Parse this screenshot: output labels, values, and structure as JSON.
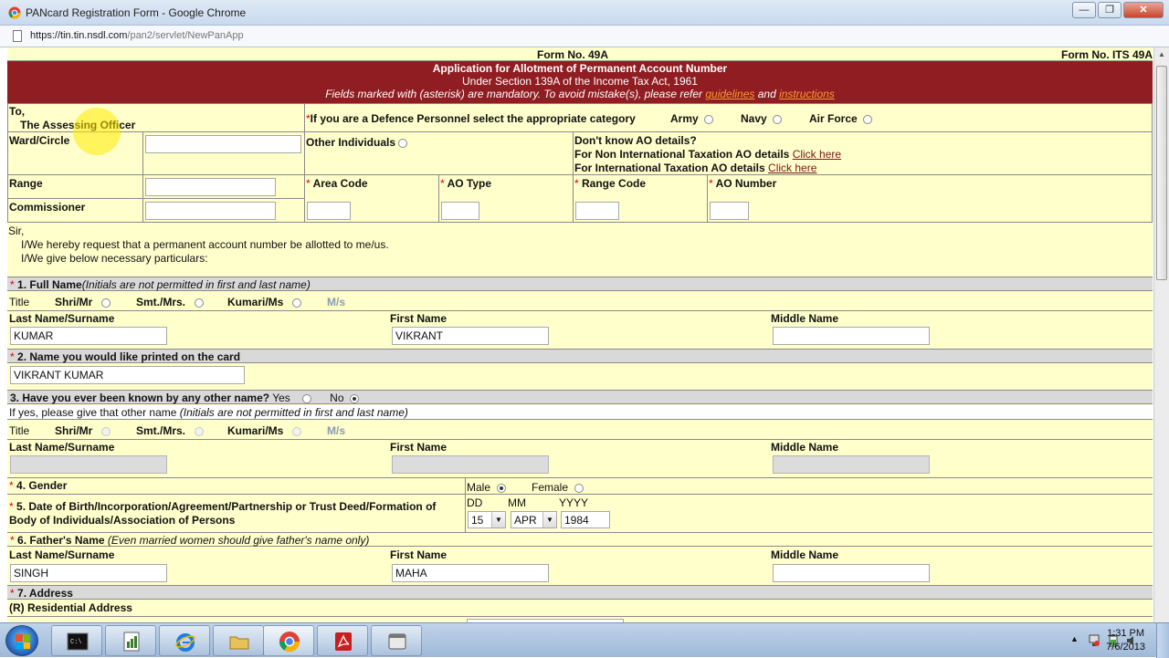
{
  "window": {
    "title": "PANcard Registration Form - Google Chrome",
    "url_host": "https://tin.tin.nsdl.com",
    "url_path": "/pan2/servlet/NewPanApp"
  },
  "header": {
    "form_no": "Form No. 49A",
    "form_its": "Form No. ITS 49A",
    "title": "Application for Allotment of Permanent Account Number",
    "subtitle": "Under Section 139A of the Income Tax Act, 1961",
    "note_pre": "Fields marked with   (asterisk) are mandatory.   To avoid mistake(s), please refer ",
    "note_link1": "guidelines",
    "note_mid": " and ",
    "note_link2": "instructions"
  },
  "ao": {
    "to": "To,",
    "assessing": "The Assessing Officer",
    "defence_q": "If you are a Defence Personnel select the appropriate category",
    "army": "Army",
    "navy": "Navy",
    "airforce": "Air Force",
    "ward": "Ward/Circle",
    "other_individuals": "Other Individuals",
    "dont_know": "Don't know AO details?",
    "non_intl": "For Non International Taxation AO details ",
    "intl": "For International Taxation AO details ",
    "click_here": "Click here",
    "range": "Range",
    "commissioner": "Commissioner",
    "area_code": "Area Code",
    "ao_type": "AO Type",
    "range_code": "Range Code",
    "ao_number": "AO Number"
  },
  "intro": {
    "sir": "Sir,",
    "line1": "I/We hereby request that a permanent account number be allotted to me/us.",
    "line2": "I/We give below necessary particulars:"
  },
  "sec1": {
    "label": "1. Full Name",
    "hint": "(Initials are not permitted in first and last name)",
    "title": "Title",
    "shri": "Shri/Mr",
    "smt": "Smt./Mrs.",
    "kumari": "Kumari/Ms",
    "ms": "M/s",
    "last": "Last Name/Surname",
    "first": "First Name",
    "middle": "Middle Name",
    "last_value": "KUMAR",
    "first_value": "VIKRANT",
    "middle_value": ""
  },
  "sec2": {
    "label": "2. Name you would like printed on the card",
    "value": "VIKRANT KUMAR"
  },
  "sec3": {
    "label": "3. Have you ever been known by any other name?",
    "yes": "Yes",
    "no": "No",
    "hint_pre": "If yes, please give that other name ",
    "hint": "(Initials are not permitted in first and last name)"
  },
  "sec4": {
    "label": "4. Gender",
    "male": "Male",
    "female": "Female"
  },
  "sec5": {
    "label_line1": "5. Date of Birth/Incorporation/Agreement/Partnership or Trust Deed/Formation of",
    "label_line2": "Body of Individuals/Association of Persons",
    "dd": "DD",
    "mm": "MM",
    "yyyy": "YYYY",
    "day": "15",
    "month": "APR",
    "year": "1984"
  },
  "sec6": {
    "label": "6. Father's Name",
    "hint": "(Even married women should give father's name only)",
    "last_value": "SINGH",
    "first_value": "MAHA"
  },
  "sec7": {
    "label": "7. Address",
    "residential": "(R) Residential Address"
  },
  "taskbar": {
    "time": "1:31 PM",
    "date": "7/6/2013"
  }
}
